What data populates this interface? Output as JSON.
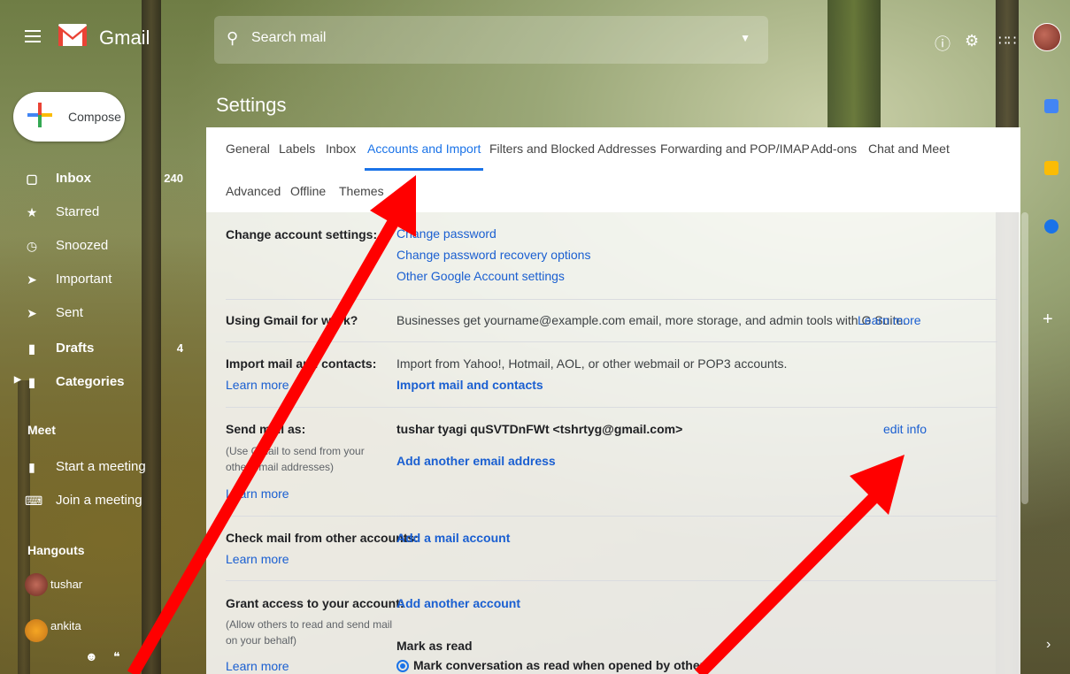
{
  "app": {
    "name": "Gmail"
  },
  "search": {
    "placeholder": "Search mail"
  },
  "compose": {
    "label": "Compose"
  },
  "sidebar": {
    "items": [
      {
        "label": "Inbox",
        "count": "240",
        "icon": "inbox-icon",
        "bold": true
      },
      {
        "label": "Starred",
        "count": "",
        "icon": "star-icon",
        "bold": false
      },
      {
        "label": "Snoozed",
        "count": "",
        "icon": "clock-icon",
        "bold": false
      },
      {
        "label": "Important",
        "count": "",
        "icon": "important-icon",
        "bold": false
      },
      {
        "label": "Sent",
        "count": "",
        "icon": "send-icon",
        "bold": false
      },
      {
        "label": "Drafts",
        "count": "4",
        "icon": "draft-icon",
        "bold": true
      },
      {
        "label": "Categories",
        "count": "",
        "icon": "label-icon",
        "bold": true
      }
    ],
    "meet_label": "Meet",
    "meet_items": [
      {
        "label": "Start a meeting",
        "icon": "video-icon"
      },
      {
        "label": "Join a meeting",
        "icon": "keyboard-icon"
      }
    ],
    "hangouts_label": "Hangouts",
    "hangouts": [
      {
        "name": "tushar"
      },
      {
        "name": "ankita"
      }
    ]
  },
  "settings": {
    "title": "Settings",
    "tabs": [
      "General",
      "Labels",
      "Inbox",
      "Accounts and Import",
      "Filters and Blocked Addresses",
      "Forwarding and POP/IMAP",
      "Add-ons",
      "Chat and Meet",
      "Advanced",
      "Offline",
      "Themes"
    ],
    "active_tab": "Accounts and Import",
    "change_account": {
      "label": "Change account settings:",
      "links": [
        "Change password",
        "Change password recovery options",
        "Other Google Account settings"
      ]
    },
    "using_gmail": {
      "label": "Using Gmail for work?",
      "text": "Businesses get yourname@example.com email, more storage, and admin tools with G Suite.",
      "link": "Learn more"
    },
    "import_mail": {
      "label": "Import mail and contacts:",
      "learn_more": "Learn more",
      "text": "Import from Yahoo!, Hotmail, AOL, or other webmail or POP3 accounts.",
      "link": "Import mail and contacts"
    },
    "send_mail": {
      "label": "Send mail as:",
      "sub": "(Use Gmail to send from your other email addresses)",
      "learn_more": "Learn more",
      "address": "tushar tyagi quSVTDnFWt <tshrtyg@gmail.com>",
      "edit": "edit info",
      "add_link": "Add another email address"
    },
    "check_mail": {
      "label": "Check mail from other accounts:",
      "link": "Add a mail account",
      "learn_more": "Learn more"
    },
    "grant_access": {
      "label": "Grant access to your account:",
      "sub": "(Allow others to read and send mail on your behalf)",
      "learn_more": "Learn more",
      "link": "Add another account",
      "mark_read_label": "Mark as read",
      "option": "Mark conversation as read when opened by others"
    }
  }
}
